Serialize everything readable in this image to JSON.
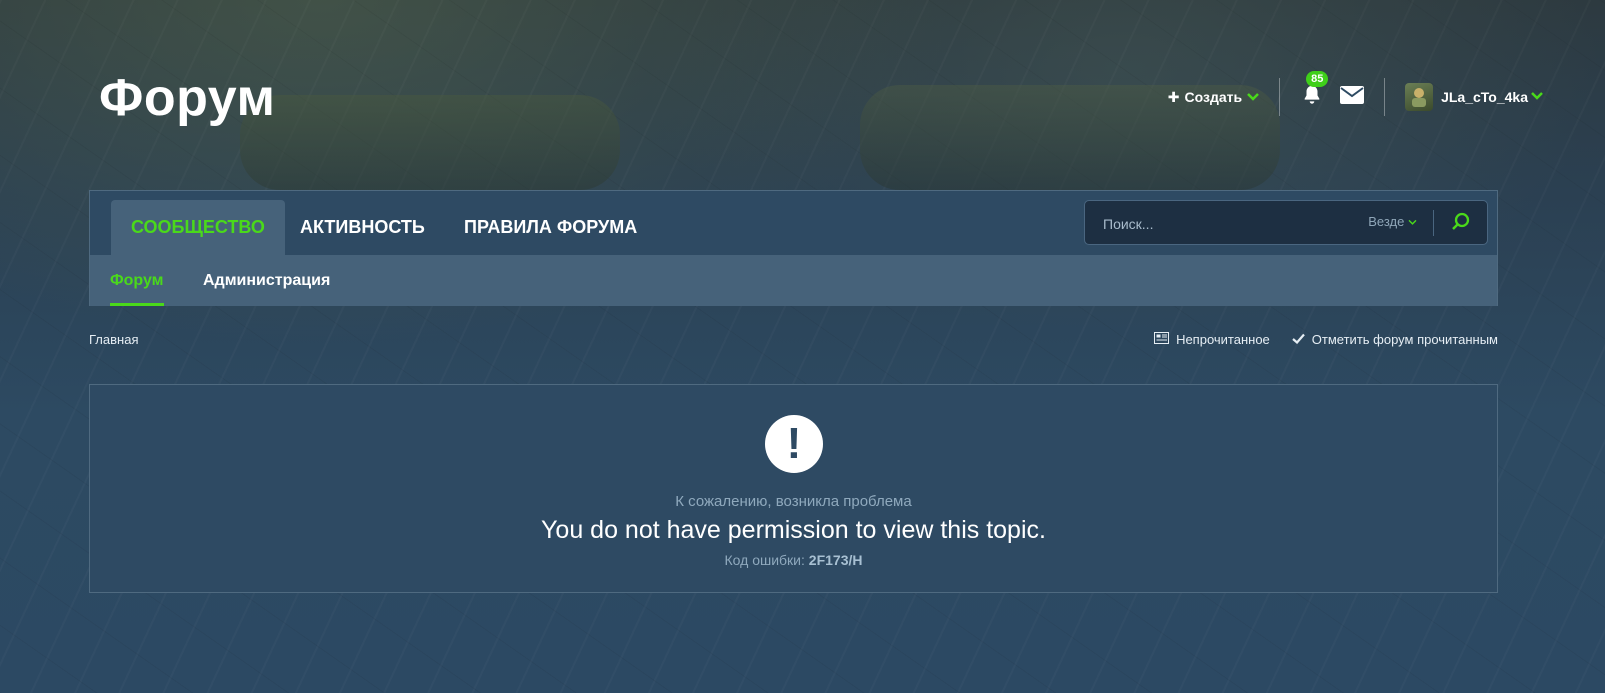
{
  "header": {
    "site_title": "Форум",
    "create_label": "Создать",
    "notifications_count": "85",
    "username": "JLa_cTo_4ka"
  },
  "nav": {
    "tabs": [
      {
        "label": "СООБЩЕСТВО",
        "active": true
      },
      {
        "label": "АКТИВНОСТЬ",
        "active": false
      },
      {
        "label": "ПРАВИЛА ФОРУМА",
        "active": false
      }
    ],
    "subtabs": [
      {
        "label": "Форум",
        "active": true
      },
      {
        "label": "Администрация",
        "active": false
      }
    ]
  },
  "search": {
    "placeholder": "Поиск...",
    "scope": "Везде"
  },
  "breadcrumb": {
    "home": "Главная"
  },
  "actions": {
    "unread": "Непрочитанное",
    "mark_read": "Отметить форум прочитанным"
  },
  "error": {
    "title": "К сожалению, возникла проблема",
    "message": "You do not have permission to view this topic.",
    "code_label": "Код ошибки:",
    "code": "2F173/H"
  },
  "colors": {
    "accent": "#4ad91a",
    "panel": "#2e4a63",
    "subnav": "#46627a"
  }
}
